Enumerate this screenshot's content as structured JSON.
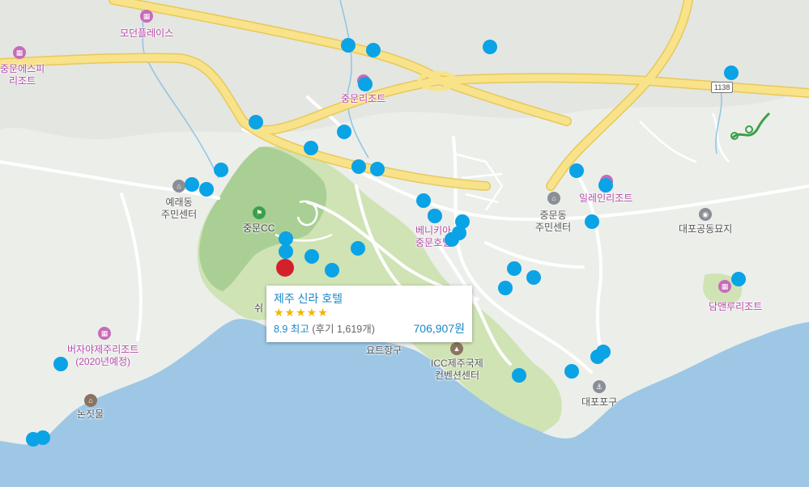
{
  "colors": {
    "sea": "#9dc7e5",
    "land": "#eceeea",
    "park": "#cfe3b4",
    "park_dark": "#a9cf95",
    "road_major": "#f8e38a",
    "road": "#ffffff",
    "marker": "#0aa3e6",
    "selected": "#d4202b",
    "link": "#1a88c7",
    "star": "#f3b500"
  },
  "labels": {
    "modern_place": "모던플레이스",
    "jungmun_spa_1": "중문에스피",
    "jungmun_spa_2": "리조트",
    "jungmun_resort": "중문리조트",
    "yerae_1": "예래동",
    "yerae_2": "주민센터",
    "jungmun_cc": "중문CC",
    "venikia_1": "베니키아",
    "venikia_2": "중문호텔",
    "jungmundong_1": "중문동",
    "jungmundong_2": "주민센터",
    "illein": "일레인리조트",
    "daepo_cemetery": "대포공동묘지",
    "damyeon": "담앤루리조트",
    "shilla_partial": "쉬",
    "yacht": "요트항구",
    "icc_1": "ICC제주국제",
    "icc_2": "컨벤션센터",
    "daepo_port": "대포포구",
    "bujaya_1": "버자야제주리조트",
    "bujaya_2": "(2020년예정)",
    "nonjitmul": "논짓물",
    "route_1138": "1138"
  },
  "popup": {
    "hotel_name": "제주 신라 호텔",
    "stars": "★★★★★",
    "score": "8.9 최고",
    "reviews": "(후기 1,619개)",
    "price": "706,907원"
  },
  "icons": {
    "resort": "building-icon",
    "office": "government-office-icon",
    "golf": "golf-flag-icon",
    "cemetery": "cemetery-icon",
    "port": "port-icon",
    "landmark": "landmark-icon",
    "trail": "trail-icon"
  }
}
